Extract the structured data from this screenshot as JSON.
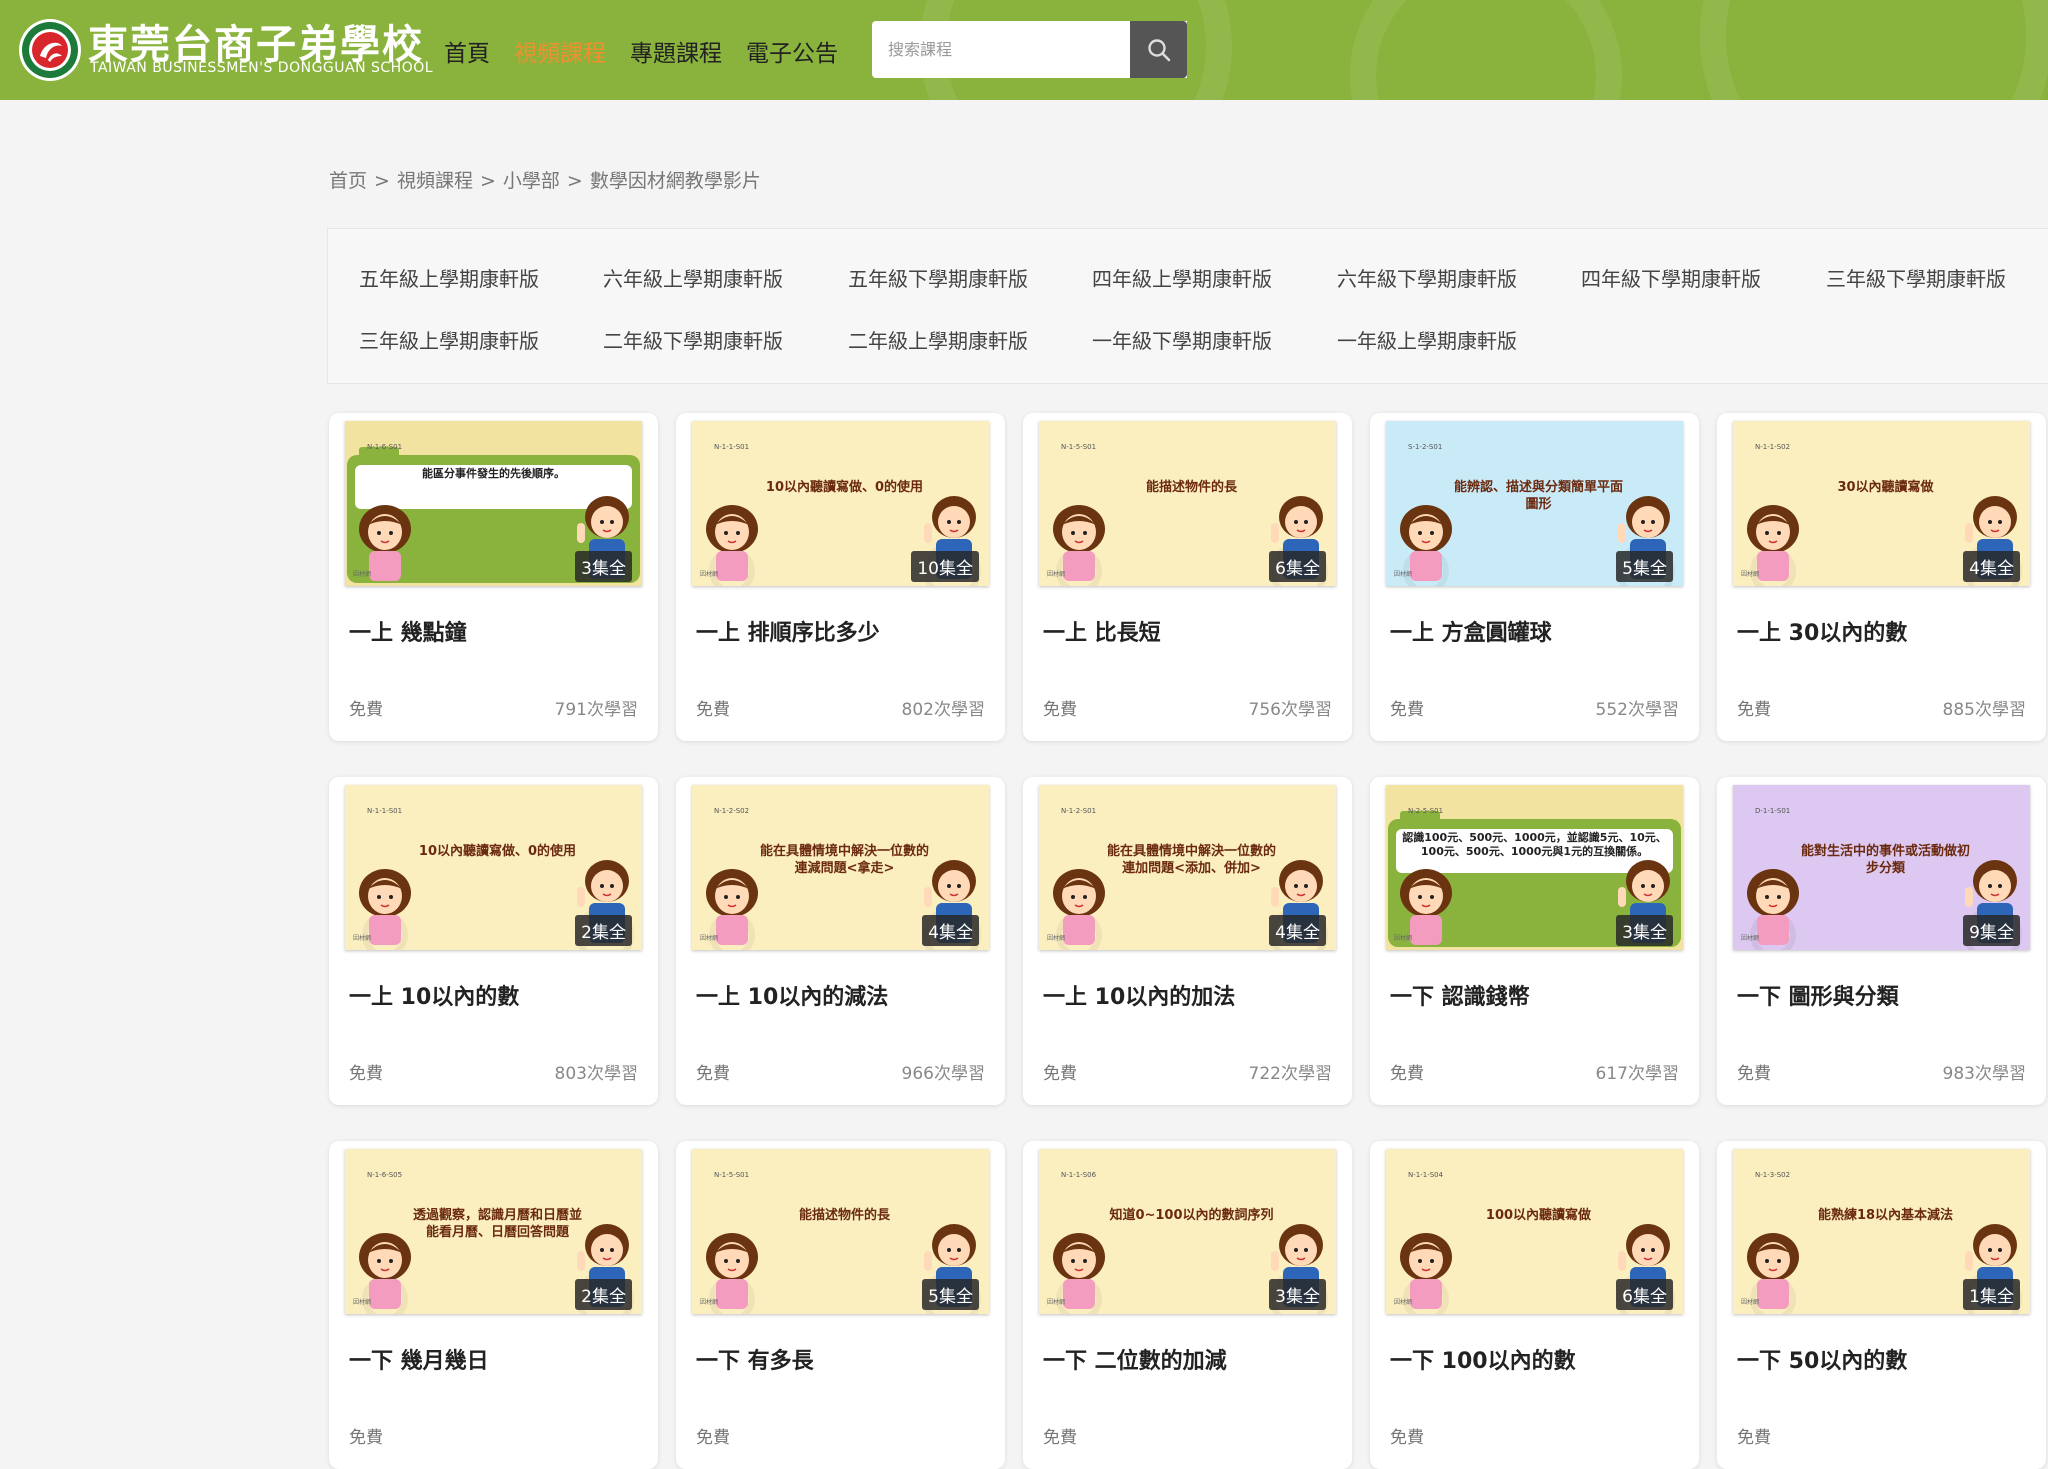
{
  "header": {
    "brand_cn": "東莞台商子弟學校",
    "brand_en": "TAIWAN BUSINESSMEN'S  DONGGUAN SCHOOL",
    "nav": [
      {
        "label": "首頁",
        "active": false
      },
      {
        "label": "視頻課程",
        "active": true
      },
      {
        "label": "專題課程",
        "active": false
      },
      {
        "label": "電子公告",
        "active": false
      }
    ],
    "search_placeholder": "搜索課程",
    "colors": {
      "bar": "#8ab33e",
      "nav_active": "#f08f2d"
    }
  },
  "breadcrumb": [
    "首页",
    "視頻課程",
    "小學部",
    "數學因材網教學影片"
  ],
  "breadcrumb_sep": ">",
  "categories": [
    "五年級上學期康軒版",
    "六年級上學期康軒版",
    "五年級下學期康軒版",
    "四年級上學期康軒版",
    "六年級下學期康軒版",
    "四年級下學期康軒版",
    "三年級下學期康軒版",
    "三年級上學期康軒版",
    "二年級下學期康軒版",
    "二年級上學期康軒版",
    "一年級下學期康軒版",
    "一年級上學期康軒版"
  ],
  "courses": [
    {
      "title": "一上 幾點鐘",
      "episodes": "3集全",
      "price": "免費",
      "count": "791次學習",
      "thumb_style": "green",
      "code": "N-1-6-S01",
      "caption": "能區分事件發生的先後順序。"
    },
    {
      "title": "一上 排順序比多少",
      "episodes": "10集全",
      "price": "免費",
      "count": "802次學習",
      "thumb_style": "cream",
      "code": "N-1-1-S01",
      "caption": "10以內聽讀寫做、0的使用"
    },
    {
      "title": "一上 比長短",
      "episodes": "6集全",
      "price": "免費",
      "count": "756次學習",
      "thumb_style": "cream",
      "code": "N-1-5-S01",
      "caption": "能描述物件的長"
    },
    {
      "title": "一上 方盒圓罐球",
      "episodes": "5集全",
      "price": "免費",
      "count": "552次學習",
      "thumb_style": "blue",
      "code": "S-1-2-S01",
      "caption": "能辨認、描述與分類簡單平面圖形"
    },
    {
      "title": "一上 30以內的數",
      "episodes": "4集全",
      "price": "免費",
      "count": "885次學習",
      "thumb_style": "cream",
      "code": "N-1-1-S02",
      "caption": "30以內聽讀寫做"
    },
    {
      "title": "一上 10以內的數",
      "episodes": "2集全",
      "price": "免費",
      "count": "803次學習",
      "thumb_style": "cream",
      "code": "N-1-1-S01",
      "caption": "10以內聽讀寫做、0的使用"
    },
    {
      "title": "一上 10以內的減法",
      "episodes": "4集全",
      "price": "免費",
      "count": "966次學習",
      "thumb_style": "cream",
      "code": "N-1-2-S02",
      "caption": "能在具體情境中解決一位數的連減問題<拿走>"
    },
    {
      "title": "一上 10以內的加法",
      "episodes": "4集全",
      "price": "免費",
      "count": "722次學習",
      "thumb_style": "cream",
      "code": "N-1-2-S01",
      "caption": "能在具體情境中解決一位數的連加問題<添加、併加>"
    },
    {
      "title": "一下 認識錢幣",
      "episodes": "3集全",
      "price": "免費",
      "count": "617次學習",
      "thumb_style": "green",
      "code": "N-2-5-S01",
      "caption": "認識100元、500元、1000元，並認識5元、10元、100元、500元、1000元與1元的互換關係。"
    },
    {
      "title": "一下 圖形與分類",
      "episodes": "9集全",
      "price": "免費",
      "count": "983次學習",
      "thumb_style": "purple",
      "code": "D-1-1-S01",
      "caption": "能對生活中的事件或活動做初步分類"
    },
    {
      "title": "一下 幾月幾日",
      "episodes": "2集全",
      "price": "免費",
      "count": "",
      "thumb_style": "cream",
      "code": "N-1-6-S05",
      "caption": "透過觀察，認識月曆和日曆並能看月曆、日曆回答問題"
    },
    {
      "title": "一下 有多長",
      "episodes": "5集全",
      "price": "免費",
      "count": "",
      "thumb_style": "cream",
      "code": "N-1-5-S01",
      "caption": "能描述物件的長"
    },
    {
      "title": "一下 二位數的加減",
      "episodes": "3集全",
      "price": "免費",
      "count": "",
      "thumb_style": "cream",
      "code": "N-1-1-S06",
      "caption": "知道0~100以內的數詞序列"
    },
    {
      "title": "一下 100以內的數",
      "episodes": "6集全",
      "price": "免費",
      "count": "",
      "thumb_style": "cream",
      "code": "N-1-1-S04",
      "caption": "100以內聽讀寫做"
    },
    {
      "title": "一下 50以內的數",
      "episodes": "1集全",
      "price": "免費",
      "count": "",
      "thumb_style": "cream",
      "code": "N-1-3-S02",
      "caption": "能熟練18以內基本減法"
    }
  ],
  "thumb_colors": {
    "cream": "#fbefc0",
    "green": "#f2e6a8",
    "blue": "#c9ebf7",
    "purple": "#dcc8f0"
  }
}
